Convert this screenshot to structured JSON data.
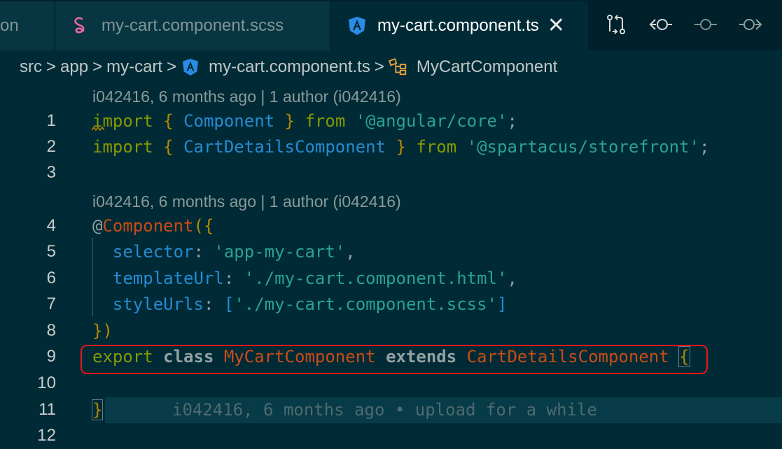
{
  "tabs": [
    {
      "label": "on",
      "icon": "none"
    },
    {
      "label": "my-cart.component.scss",
      "icon": "sass-icon",
      "color": "#e76aa3"
    },
    {
      "label": "my-cart.component.ts",
      "icon": "angular-icon",
      "color": "#2b8be6",
      "active": true,
      "close": "✕"
    }
  ],
  "actions": [
    "open-changes-icon",
    "go-to-previous-change-icon",
    "git-commit-icon",
    "go-to-next-change-icon"
  ],
  "breadcrumb": {
    "items": [
      "src",
      "app",
      "my-cart",
      "my-cart.component.ts",
      "MyCartComponent"
    ],
    "separator": ">"
  },
  "codelens": {
    "first": "i042416, 6 months ago | 1 author (i042416)",
    "second": "i042416, 6 months ago | 1 author (i042416)"
  },
  "lines": {
    "n1": "1",
    "n2": "2",
    "n3": "3",
    "n4": "4",
    "n5": "5",
    "n6": "6",
    "n7": "7",
    "n8": "8",
    "n9": "9",
    "n10": "10",
    "n11": "11",
    "n12": "12"
  },
  "code": {
    "l1": {
      "import": "import",
      "open": "{",
      "name": "Component",
      "close": "}",
      "from": "from",
      "module": "'@angular/core'",
      "semi": ";"
    },
    "l2": {
      "import": "import",
      "open": "{",
      "name": "CartDetailsComponent",
      "close": "}",
      "from": "from",
      "module": "'@spartacus/storefront'",
      "semi": ";"
    },
    "l4": {
      "at": "@",
      "dec": "Component",
      "open": "({"
    },
    "l5": {
      "key": "selector",
      "colon": ":",
      "value": "'app-my-cart'",
      "comma": ","
    },
    "l6": {
      "key": "templateUrl",
      "colon": ":",
      "value": "'./my-cart.component.html'",
      "comma": ","
    },
    "l7": {
      "key": "styleUrls",
      "colon": ":",
      "lb": "[",
      "value": "'./my-cart.component.scss'",
      "rb": "]"
    },
    "l8": {
      "close": "})"
    },
    "l9": {
      "export": "export",
      "class": "class",
      "name": "MyCartComponent",
      "extends": "extends",
      "parent": "CartDetailsComponent",
      "brace": "{"
    },
    "l11": {
      "brace": "}",
      "blame": "i042416, 6 months ago • upload for a while"
    }
  },
  "colors": {
    "background": "#002b36",
    "tabbar": "#00212b",
    "highlight": "#e8161b"
  }
}
